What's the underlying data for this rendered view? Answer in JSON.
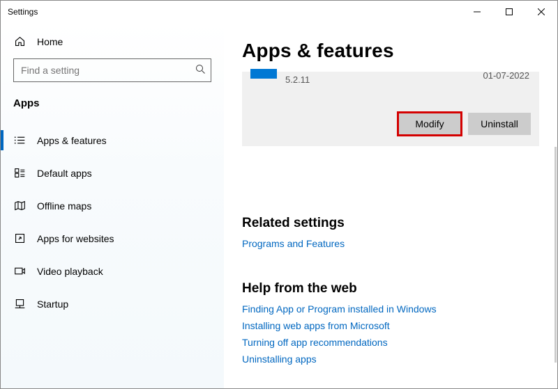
{
  "window": {
    "title": "Settings"
  },
  "sidebar": {
    "home_label": "Home",
    "search_placeholder": "Find a setting",
    "section_heading": "Apps",
    "items": [
      {
        "label": "Apps & features"
      },
      {
        "label": "Default apps"
      },
      {
        "label": "Offline maps"
      },
      {
        "label": "Apps for websites"
      },
      {
        "label": "Video playback"
      },
      {
        "label": "Startup"
      }
    ]
  },
  "main": {
    "title": "Apps & features",
    "app": {
      "version": "5.2.11",
      "date": "01-07-2022"
    },
    "buttons": {
      "modify": "Modify",
      "uninstall": "Uninstall"
    },
    "related": {
      "heading": "Related settings",
      "links": [
        "Programs and Features"
      ]
    },
    "help": {
      "heading": "Help from the web",
      "links": [
        "Finding App or Program installed in Windows",
        "Installing web apps from Microsoft",
        "Turning off app recommendations",
        "Uninstalling apps"
      ]
    }
  }
}
